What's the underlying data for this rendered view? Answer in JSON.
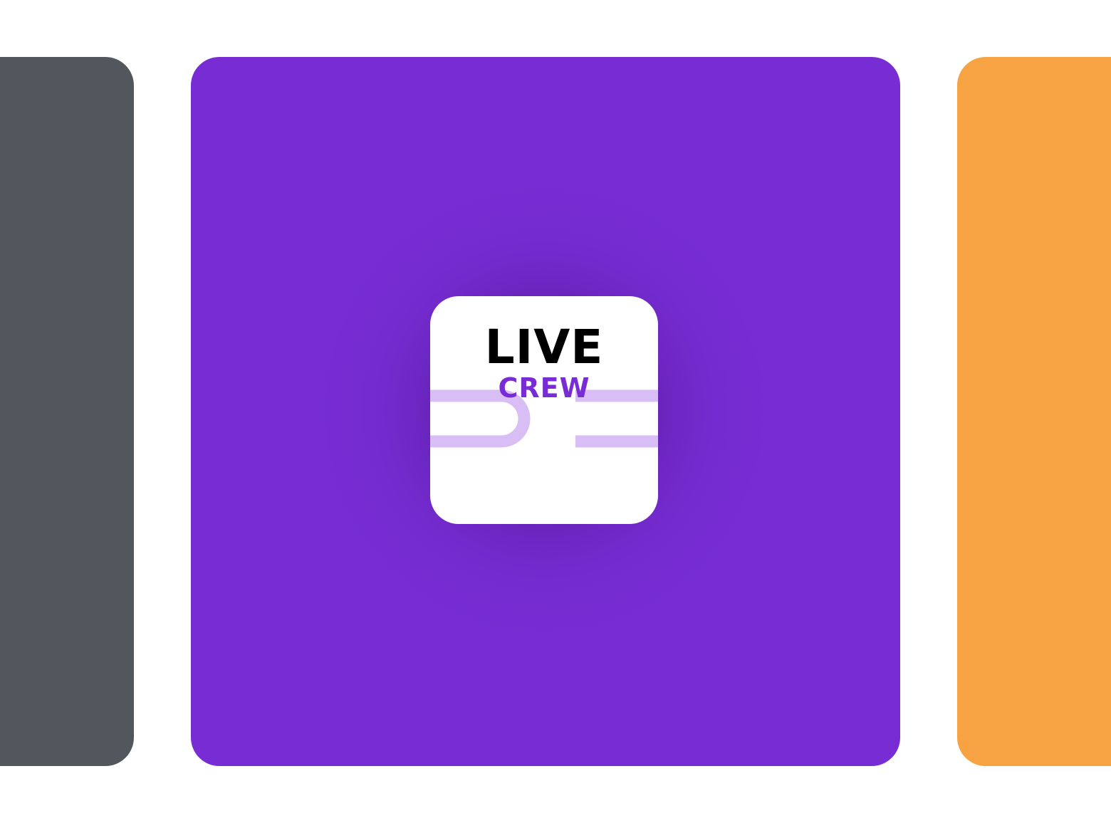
{
  "colors": {
    "left_panel": "#52575d",
    "center_panel": "#772dd3",
    "right_panel": "#f8a343",
    "icon_background": "#ffffff",
    "title_color": "#000000",
    "subtitle_color": "#772dd3",
    "stripe_color": "#d9bdf5"
  },
  "app_icon": {
    "title": "LIVE",
    "subtitle": "CREW"
  }
}
